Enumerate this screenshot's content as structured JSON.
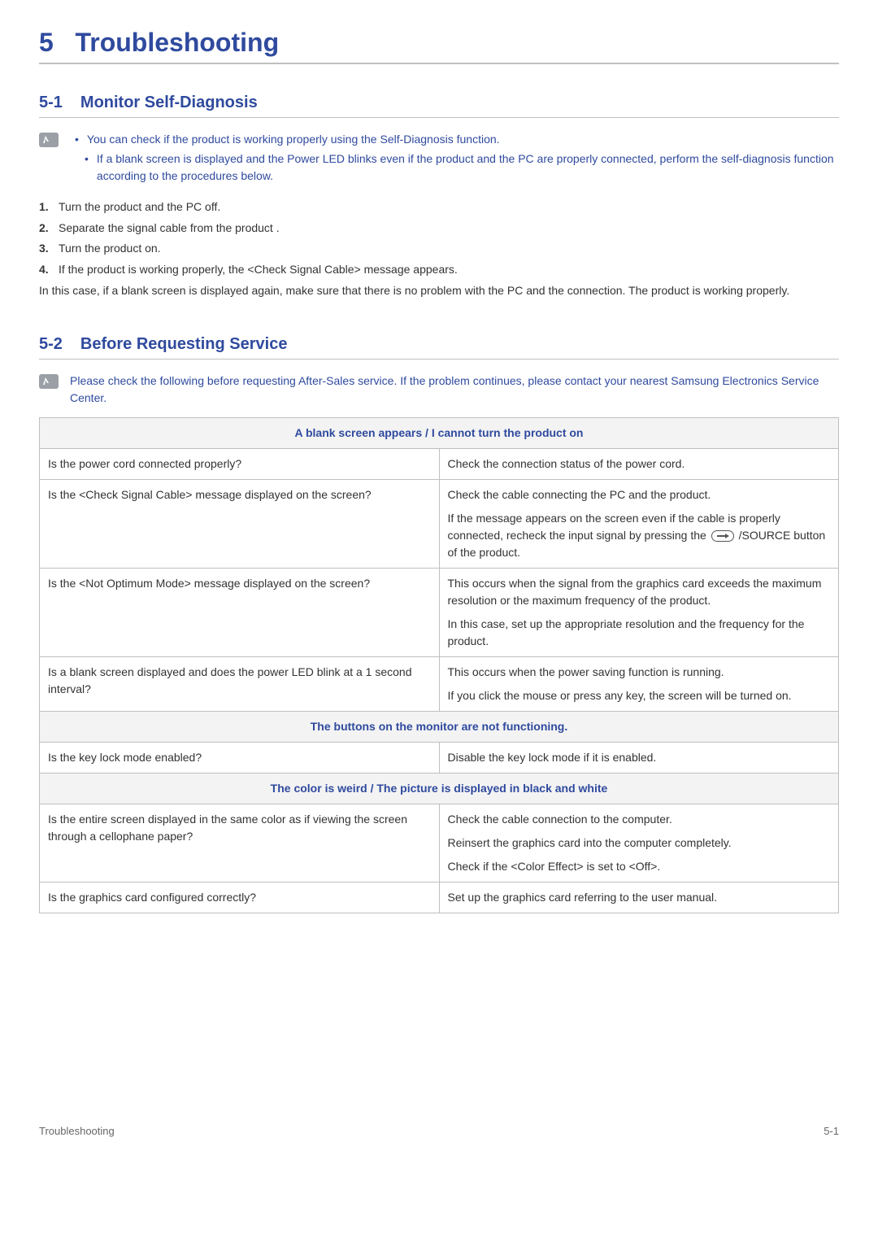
{
  "chapter": {
    "num": "5",
    "title": "Troubleshooting"
  },
  "section1": {
    "num": "5-1",
    "title": "Monitor Self-Diagnosis",
    "notes": [
      "You can check if the product is working properly using the Self-Diagnosis function.",
      "If a blank screen is displayed and the Power LED blinks even if the product and the PC are properly connected, perform the self-diagnosis function according to the procedures below."
    ],
    "steps": [
      {
        "n": "1.",
        "t": "Turn the product and the PC off."
      },
      {
        "n": "2.",
        "t": "Separate the signal cable from the product ."
      },
      {
        "n": "3.",
        "t": "Turn the product on."
      },
      {
        "n": "4.",
        "t": "If the product is working properly, the <Check Signal Cable> message appears."
      }
    ],
    "post": "In this case, if a blank screen is displayed again, make sure that there is no problem with the PC and the connection. The product is working properly."
  },
  "section2": {
    "num": "5-2",
    "title": "Before Requesting Service",
    "note": "Please check the following before requesting After-Sales service. If the problem continues, please contact your nearest Samsung Electronics Service Center.",
    "headers": {
      "h1": "A blank screen appears / I cannot turn the product on",
      "h2": "The buttons on the monitor are not functioning.",
      "h3": "The color is weird / The picture is displayed in black and white"
    },
    "rows": {
      "r1": {
        "q": "Is the power cord connected properly?",
        "a": "Check the connection status of the power cord."
      },
      "r2": {
        "q": "Is the <Check Signal Cable> message displayed on the screen?",
        "a1": "Check the cable connecting the PC and the product.",
        "a2_pre": "If the message appears on the screen even if the cable is properly connected, recheck the input signal by pressing the ",
        "a2_post": " /SOURCE button of the product."
      },
      "r3": {
        "q": "Is the <Not Optimum Mode> message displayed on the screen?",
        "a1": "This occurs when the signal from the graphics card exceeds the maximum resolution or the maximum frequency of the product.",
        "a2": "In this case, set up the appropriate resolution and the frequency for the product."
      },
      "r4": {
        "q": "Is a blank screen displayed and does the power LED blink at a 1 second interval?",
        "a1": "This occurs when the power saving function is running.",
        "a2": "If you click the mouse or press any key, the screen will be turned on."
      },
      "r5": {
        "q": "Is the key lock mode enabled?",
        "a": "Disable the key lock mode if it is enabled."
      },
      "r6": {
        "q": "Is the entire screen displayed in the same color as if viewing the screen through a cellophane paper?",
        "a1": "Check the cable connection to the computer.",
        "a2": "Reinsert the graphics card into the computer completely.",
        "a3": "Check if the <Color Effect> is set to <Off>."
      },
      "r7": {
        "q": "Is the graphics card configured correctly?",
        "a": "Set up the graphics card referring to the user manual."
      }
    }
  },
  "footer": {
    "left": "Troubleshooting",
    "right": "5-1"
  }
}
